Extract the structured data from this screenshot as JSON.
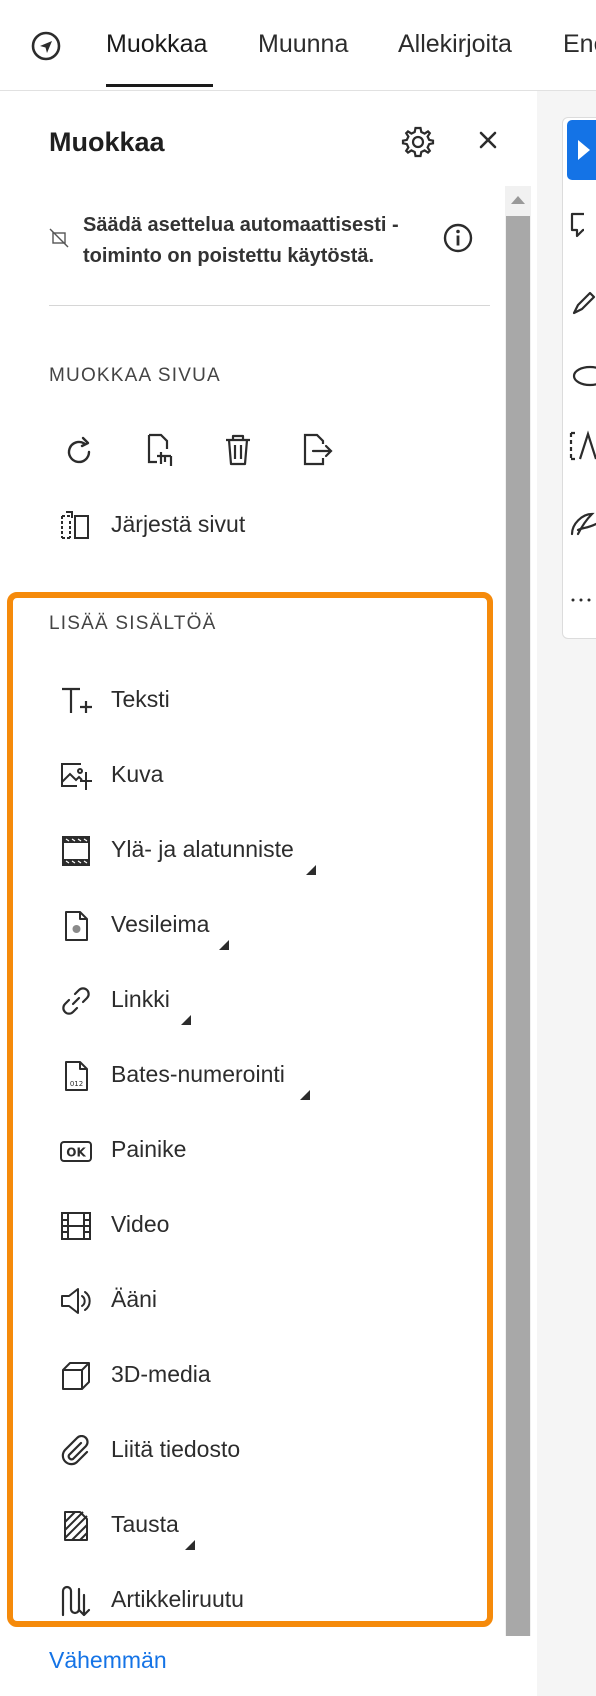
{
  "nav": {
    "tabs": [
      "Muokkaa",
      "Muunna",
      "Allekirjoita",
      "Enemmän"
    ],
    "active_tab": "Muokkaa",
    "home_icon": "adobe-home-icon"
  },
  "panel": {
    "title": "Muokkaa",
    "settings_icon": "gear-icon",
    "close_icon": "close-icon",
    "info_text": "Säädä asettelua automaattisesti -toiminto on poistettu käytöstä.",
    "info_icon": "info-icon",
    "edit_page_section": {
      "label": "MUOKKAA SIVUA",
      "tools": [
        {
          "icon": "rotate-icon"
        },
        {
          "icon": "crop-page-icon"
        },
        {
          "icon": "delete-icon"
        },
        {
          "icon": "extract-page-icon"
        }
      ],
      "organize_label": "Järjestä sivut"
    },
    "add_content_section": {
      "label": "LISÄÄ SISÄLTÖÄ",
      "items": [
        {
          "label": "Teksti",
          "icon": "add-text-icon",
          "has_submenu": false
        },
        {
          "label": "Kuva",
          "icon": "add-image-icon",
          "has_submenu": false
        },
        {
          "label": "Ylä- ja alatunniste",
          "icon": "header-footer-icon",
          "has_submenu": true
        },
        {
          "label": "Vesileima",
          "icon": "watermark-icon",
          "has_submenu": true
        },
        {
          "label": "Linkki",
          "icon": "link-icon",
          "has_submenu": true
        },
        {
          "label": "Bates-numerointi",
          "icon": "bates-numbering-icon",
          "has_submenu": true
        },
        {
          "label": "Painike",
          "icon": "button-ok-icon",
          "has_submenu": false
        },
        {
          "label": "Video",
          "icon": "video-icon",
          "has_submenu": false
        },
        {
          "label": "Ääni",
          "icon": "speaker-icon",
          "has_submenu": false
        },
        {
          "label": "3D-media",
          "icon": "cube-icon",
          "has_submenu": false
        },
        {
          "label": "Liitä tiedosto",
          "icon": "paperclip-icon",
          "has_submenu": false
        },
        {
          "label": "Tausta",
          "icon": "background-icon",
          "has_submenu": true
        },
        {
          "label": "Artikkeliruutu",
          "icon": "article-box-icon",
          "has_submenu": false
        }
      ]
    },
    "less_link": "Vähemmän"
  },
  "colors": {
    "accent": "#1473e6",
    "highlight": "#f58a0b"
  }
}
